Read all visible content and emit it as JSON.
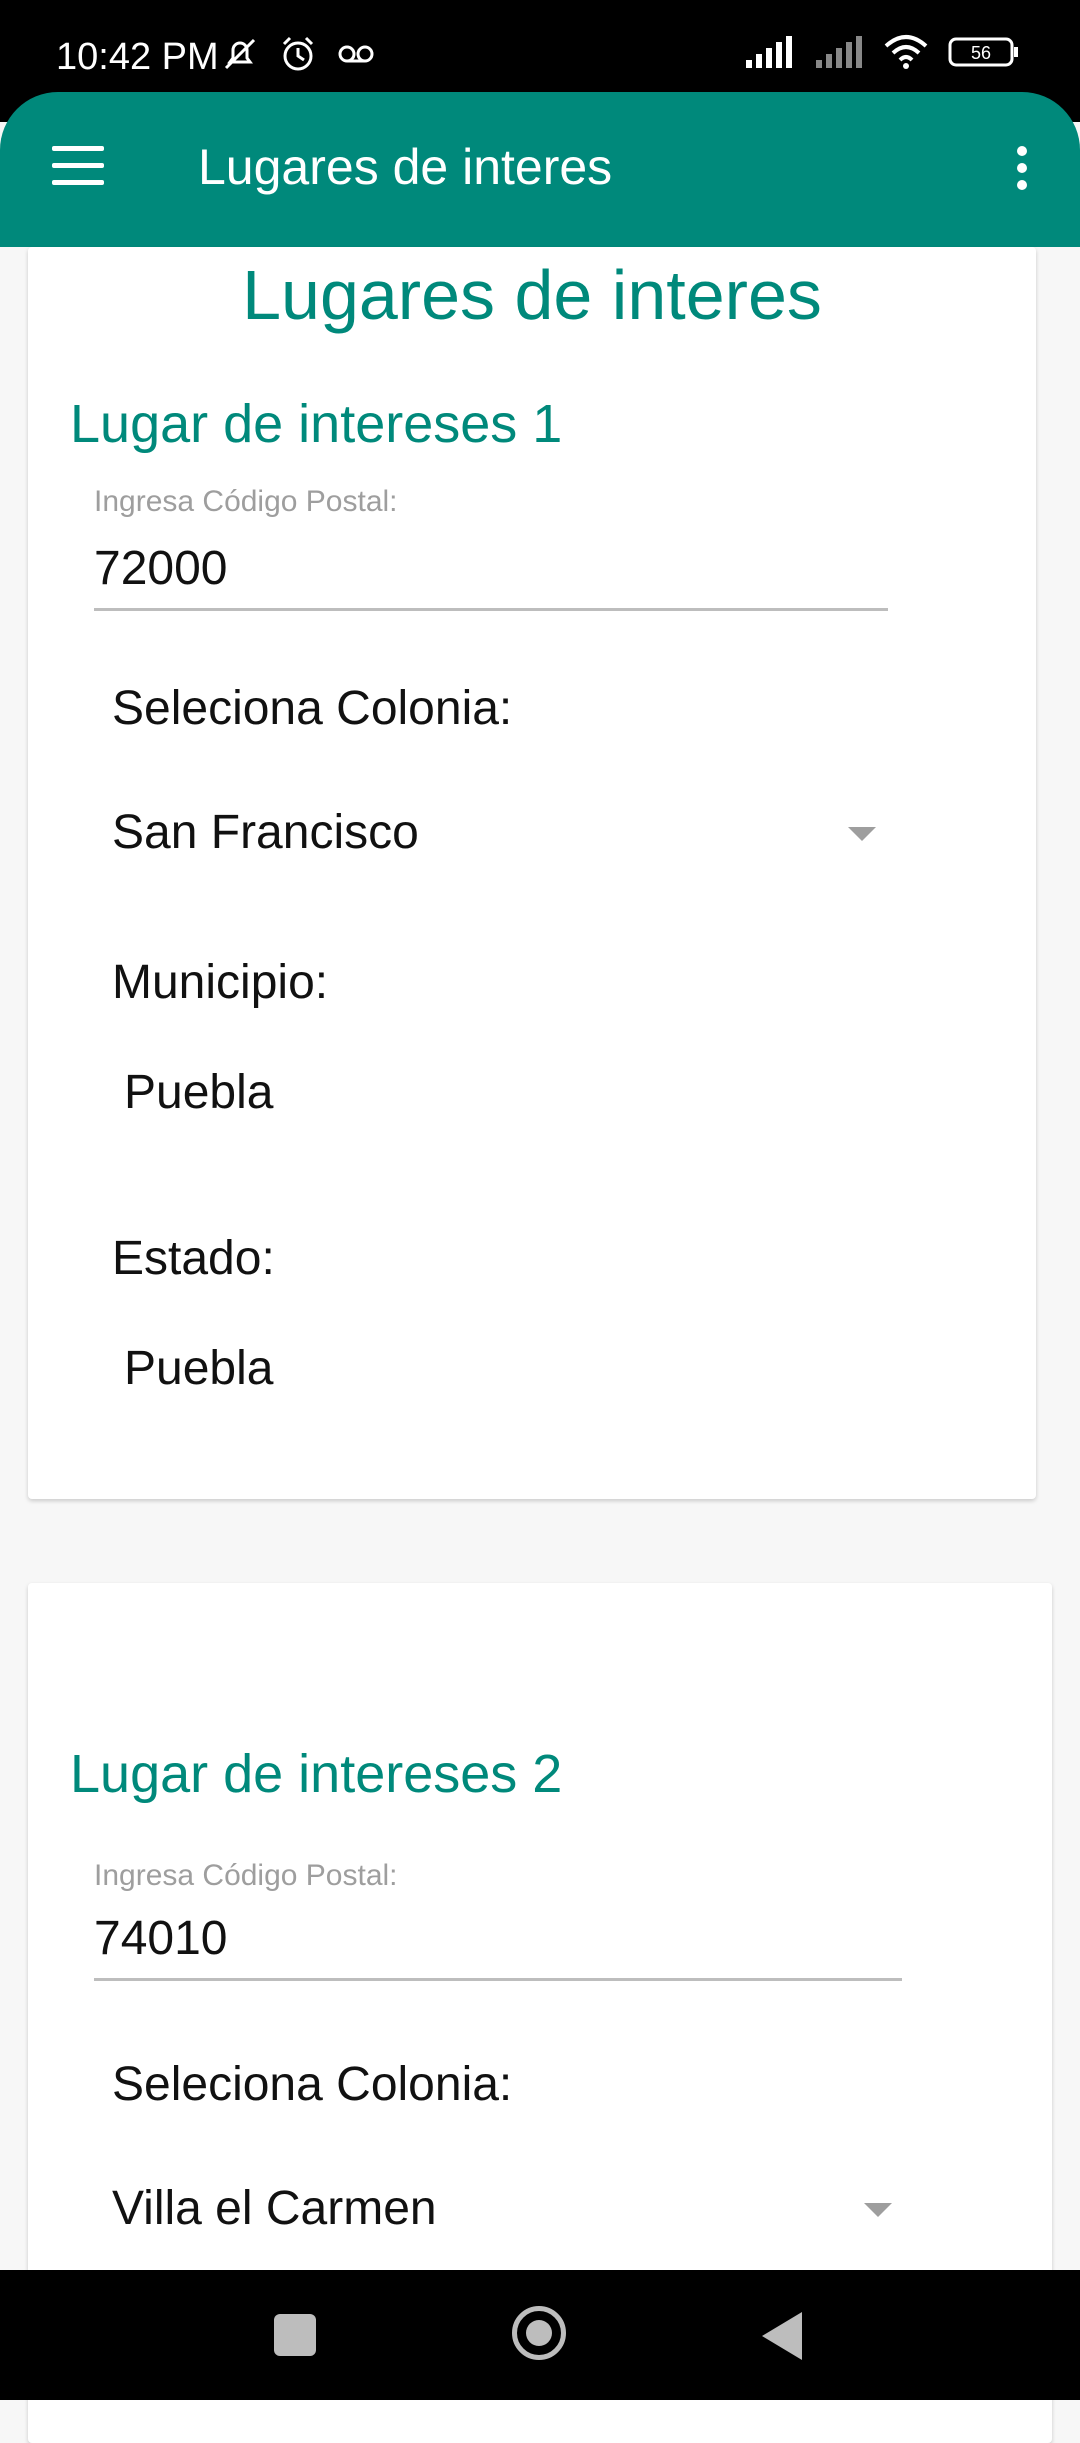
{
  "status_bar": {
    "time": "10:42 PM",
    "battery": "56",
    "icons_left": [
      "mute-icon",
      "alarm-icon",
      "voicemail-icon"
    ],
    "icons_right": [
      "signal-icon",
      "signal-icon",
      "wifi-icon",
      "battery-icon"
    ]
  },
  "app_bar": {
    "title": "Lugares de interes",
    "background": "#00897b"
  },
  "page": {
    "heading": "Lugares de interes"
  },
  "places": [
    {
      "title": "Lugar de intereses 1",
      "postal_label": "Ingresa Código Postal:",
      "postal_value": "72000",
      "colonia_label": "Seleciona Colonia:",
      "colonia_value": "San Francisco",
      "municipio_label": "Municipio:",
      "municipio_value": "Puebla",
      "estado_label": "Estado:",
      "estado_value": "Puebla"
    },
    {
      "title": "Lugar de intereses 2",
      "postal_label": "Ingresa Código Postal:",
      "postal_value": "74010",
      "colonia_label": "Seleciona Colonia:",
      "colonia_value": "Villa el Carmen"
    }
  ],
  "colors": {
    "accent": "#00897b",
    "hint": "#9e9e9e"
  }
}
